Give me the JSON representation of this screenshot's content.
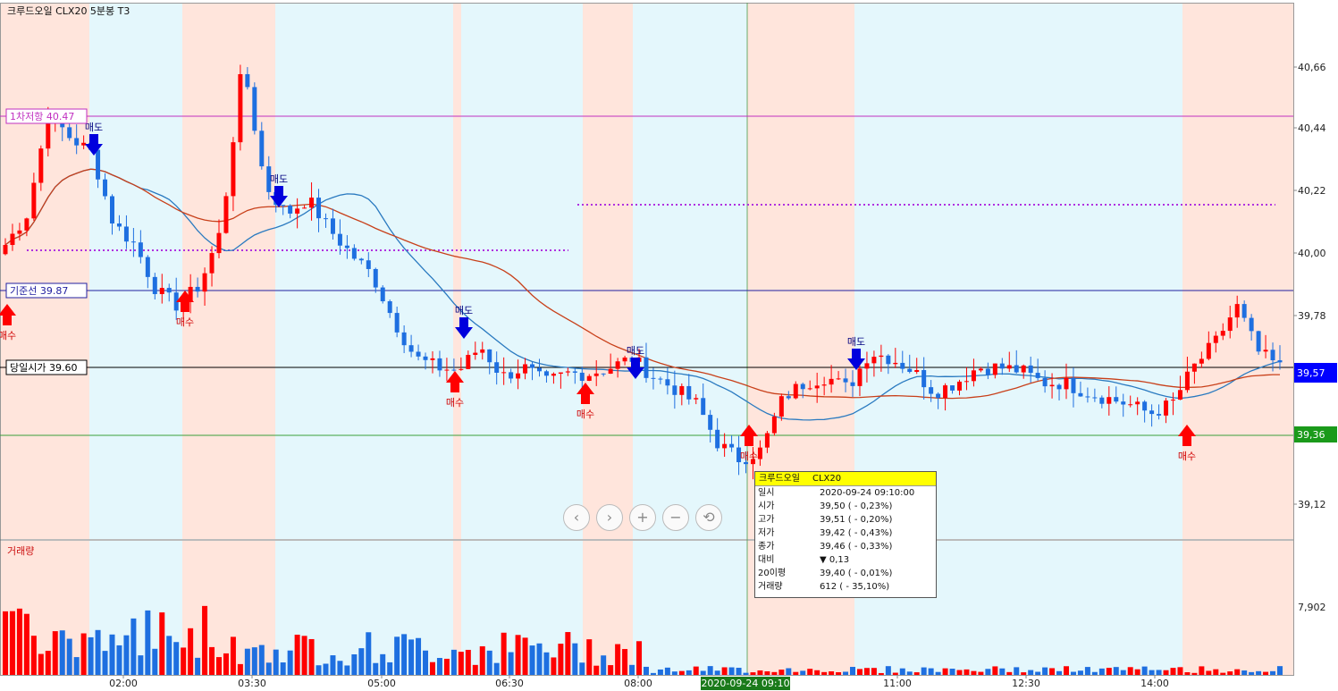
{
  "header": {
    "instrument": "크루드오일",
    "code": "CLX20",
    "period": "5분봉",
    "tag": "T3"
  },
  "colors": {
    "up": "#ff0000",
    "down": "#1e6fe0",
    "buy_band": "#ffe5dc",
    "sell_band": "#e4f7fc",
    "ma20": "#2a7ac0",
    "ma_slow": "#c8401a",
    "resistance": "#c030c0",
    "base_line": "#2020a0",
    "open_line": "#000000",
    "green_line": "#3aa03a",
    "dotted": "#b030e0"
  },
  "reference_lines": {
    "resistance": "1차저항 40.47",
    "base_line": "기준선 39.87",
    "open_line": "당일시가 39.60"
  },
  "price_axis": {
    "ticks": [
      "40,66",
      "40,44",
      "40,22",
      "40,00",
      "39,78",
      "39,12"
    ],
    "current_price": "39,57",
    "green_price": "39,36"
  },
  "volume_panel": {
    "label": "거래량",
    "tick": "7,902"
  },
  "time_axis": {
    "ticks": [
      "02:00",
      "03:30",
      "05:00",
      "06:30",
      "08:00",
      "11:00",
      "12:30",
      "14:00"
    ],
    "cursor_time": "2020-09-24 09:10"
  },
  "signals": {
    "buy": "매수",
    "sell": "매도"
  },
  "tooltip": {
    "instrument": "크루드오일",
    "code": "CLX20",
    "rows": [
      {
        "k": "일시",
        "v": "2020-09-24 09:10:00"
      },
      {
        "k": "시가",
        "v": "39,50 ( - 0,23%)"
      },
      {
        "k": "고가",
        "v": "39,51 ( - 0,20%)"
      },
      {
        "k": "저가",
        "v": "39,42 ( - 0,43%)"
      },
      {
        "k": "종가",
        "v": "39,46 ( - 0,33%)"
      },
      {
        "k": "대비",
        "v": "▼ 0,13"
      },
      {
        "k": "20이평",
        "v": "39,40 ( - 0,01%)"
      },
      {
        "k": "거래량",
        "v": "612 ( - 35,10%)"
      }
    ]
  },
  "nav_buttons": [
    "‹",
    "›",
    "+",
    "−",
    "⟲"
  ],
  "chart_data": {
    "type": "candlestick",
    "ylim": [
      38.99,
      40.74
    ],
    "close_path": [
      39.95,
      40.05,
      40.38,
      40.3,
      40.25,
      40.02,
      39.95,
      39.8,
      39.75,
      39.82,
      40.0,
      40.55,
      40.15,
      40.05,
      40.1,
      40.0,
      39.92,
      39.85,
      39.7,
      39.58,
      39.55,
      39.54,
      39.62,
      39.52,
      39.55,
      39.5,
      39.53,
      39.53,
      39.55,
      39.58,
      39.52,
      39.48,
      39.43,
      39.3,
      39.25,
      39.28,
      39.45,
      39.5,
      39.52,
      39.48,
      39.6,
      39.58,
      39.54,
      39.47,
      39.5,
      39.55,
      39.55,
      39.54,
      39.5,
      39.5,
      39.47,
      39.45,
      39.43,
      39.4,
      39.43,
      39.55,
      39.63,
      39.75,
      39.6,
      39.55
    ],
    "sell_signals_x": [
      105,
      312,
      519,
      711,
      958
    ],
    "buy_signals_x": [
      8,
      207,
      509,
      655,
      838,
      1328
    ]
  }
}
